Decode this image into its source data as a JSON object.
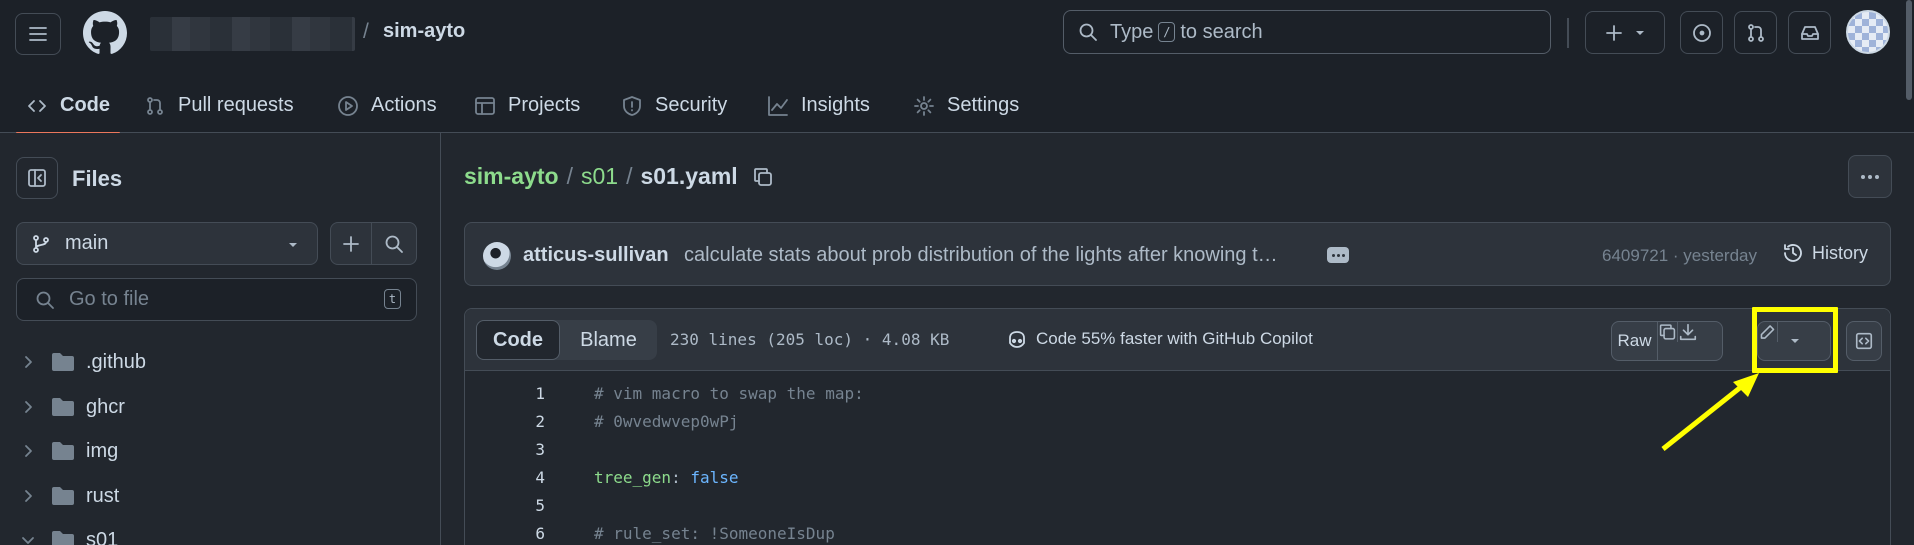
{
  "header": {
    "repo_name": "sim-ayto",
    "repo_sep": "/",
    "search": {
      "before": "Type",
      "key": "/",
      "after": "to search"
    }
  },
  "tabs": [
    {
      "label": "Code",
      "icon": "code-icon"
    },
    {
      "label": "Pull requests",
      "icon": "git-pull-request-icon"
    },
    {
      "label": "Actions",
      "icon": "play-icon"
    },
    {
      "label": "Projects",
      "icon": "table-icon"
    },
    {
      "label": "Security",
      "icon": "shield-icon"
    },
    {
      "label": "Insights",
      "icon": "graph-icon"
    },
    {
      "label": "Settings",
      "icon": "gear-icon"
    }
  ],
  "sidebar": {
    "title": "Files",
    "branch": "main",
    "goto_placeholder": "Go to file",
    "goto_key": "t",
    "tree": [
      {
        "name": ".github",
        "expanded": false
      },
      {
        "name": "ghcr",
        "expanded": false
      },
      {
        "name": "img",
        "expanded": false
      },
      {
        "name": "rust",
        "expanded": false
      },
      {
        "name": "s01",
        "expanded": true
      }
    ]
  },
  "breadcrumb": {
    "repo": "sim-ayto",
    "sep": "/",
    "folder": "s01",
    "file": "s01.yaml"
  },
  "commit": {
    "author": "atticus-sullivan",
    "message": "calculate stats about prob distribution of the lights after knowing t…",
    "sha_time": "6409721 · yesterday",
    "history_label": "History"
  },
  "file": {
    "code_tab": "Code",
    "blame_tab": "Blame",
    "meta": "230 lines (205 loc) · 4.08 KB",
    "copilot": "Code 55% faster with GitHub Copilot",
    "raw_label": "Raw",
    "lines": [
      {
        "n": "1",
        "comment": "# vim macro to swap the map:"
      },
      {
        "n": "2",
        "comment": "# 0wvedwvep0wPj"
      },
      {
        "n": "3"
      },
      {
        "n": "4",
        "key": "tree_gen",
        "punct": ":",
        "value": "false"
      },
      {
        "n": "5"
      },
      {
        "n": "6",
        "comment": "# rule_set: !SomeoneIsDup"
      }
    ]
  },
  "colors": {
    "background": "#22272e",
    "header": "#1c2128",
    "accent_tab_underline": "#ec775c",
    "link_green": "#8ddb8c",
    "annotation_yellow": "#ffff00"
  }
}
